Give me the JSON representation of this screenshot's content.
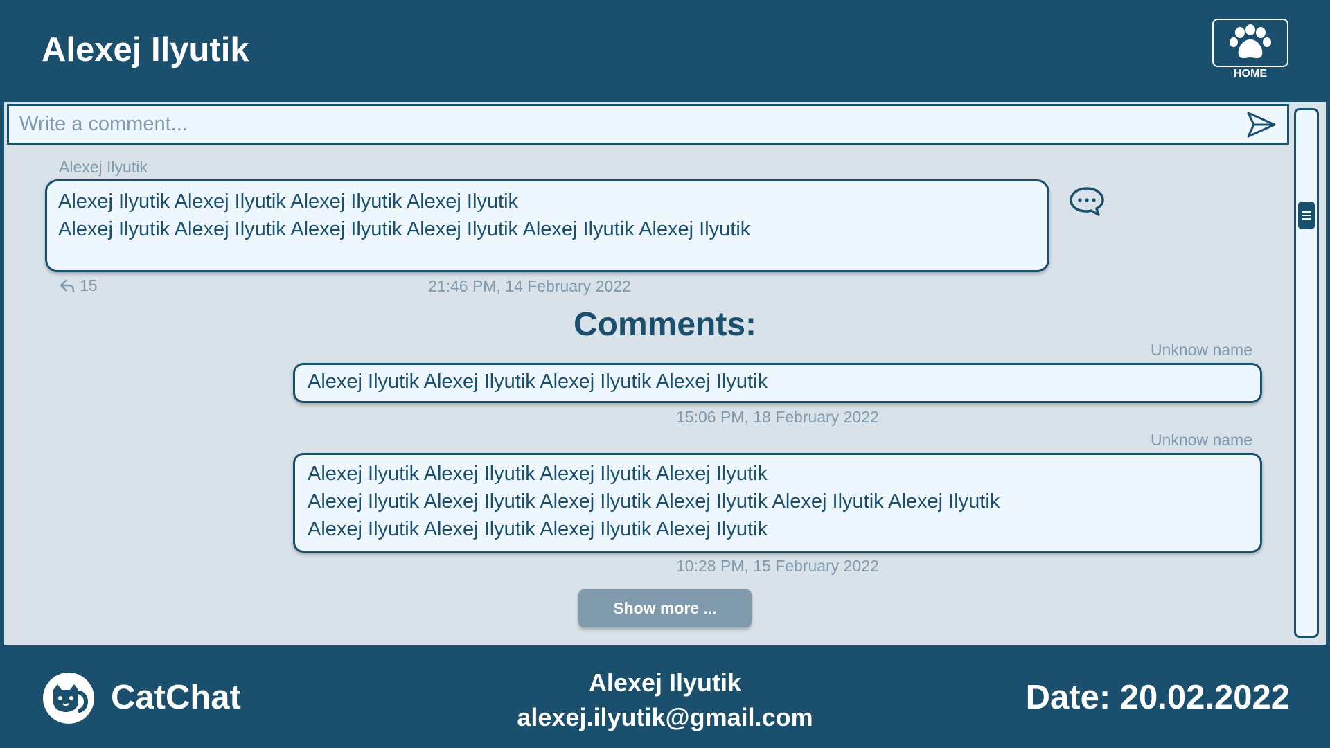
{
  "header": {
    "title": "Alexej Ilyutik",
    "home_label": "HOME",
    "home_icon": "paw-icon"
  },
  "composer": {
    "placeholder": "Write a comment...",
    "send_icon": "send-icon"
  },
  "post": {
    "author": "Alexej Ilyutik",
    "lines": [
      "Alexej Ilyutik Alexej Ilyutik Alexej Ilyutik Alexej Ilyutik",
      " Alexej Ilyutik Alexej Ilyutik Alexej Ilyutik Alexej Ilyutik Alexej Ilyutik Alexej Ilyutik"
    ],
    "reply_count": "15",
    "time": "21:46 PM, 14 February 2022"
  },
  "comments_heading": "Comments:",
  "comments": [
    {
      "author": "Unknow name",
      "lines": [
        "Alexej Ilyutik Alexej Ilyutik Alexej Ilyutik Alexej Ilyutik"
      ],
      "time": "15:06 PM, 18 February 2022"
    },
    {
      "author": "Unknow name",
      "lines": [
        "Alexej Ilyutik Alexej Ilyutik Alexej Ilyutik Alexej Ilyutik",
        " Alexej Ilyutik Alexej Ilyutik Alexej Ilyutik Alexej Ilyutik Alexej Ilyutik Alexej Ilyutik",
        "Alexej Ilyutik Alexej Ilyutik Alexej Ilyutik Alexej Ilyutik"
      ],
      "time": "10:28 PM, 15 February 2022"
    }
  ],
  "show_more_label": "Show more ...",
  "footer": {
    "brand": "CatChat",
    "user_name": "Alexej Ilyutik",
    "user_email": "alexej.ilyutik@gmail.com",
    "date": "Date: 20.02.2022"
  },
  "colors": {
    "primary": "#1b4f6e",
    "panel": "#d8e2e8",
    "bubble": "#eef7fd",
    "muted": "#7f9aad"
  }
}
